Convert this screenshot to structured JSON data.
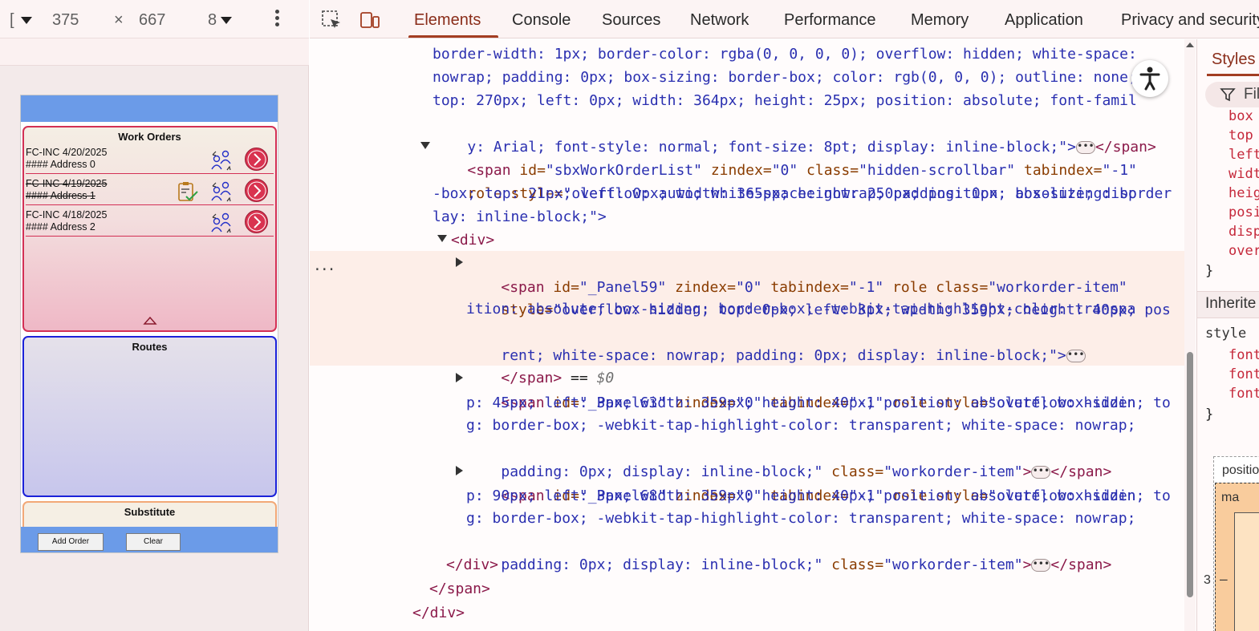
{
  "device_toolbar": {
    "device_label": "[",
    "width": "375",
    "times": "×",
    "height": "667",
    "zoom": "8"
  },
  "phone_app": {
    "work_orders_title": "Work Orders",
    "work_orders": [
      {
        "line1": "FC-INC 4/20/2025",
        "line2": "#### Address 0"
      },
      {
        "line1": "FC-INC 4/19/2025",
        "line2": "#### Address 1"
      },
      {
        "line1": "FC-INC 4/18/2025",
        "line2": "#### Address 2"
      }
    ],
    "routes_title": "Routes",
    "substitute_title": "Substitute",
    "add_order_label": "Add Order",
    "clear_label": "Clear"
  },
  "devtools_tabs": [
    "Elements",
    "Console",
    "Sources",
    "Network",
    "Performance",
    "Memory",
    "Application",
    "Privacy and security"
  ],
  "code": {
    "l1": "border-width: 1px; border-color: rgba(0, 0, 0, 0); overflow: hidden; white-space:",
    "l2": "nowrap; padding: 0px; box-sizing: border-box; color: rgb(0, 0, 0); outline: none;",
    "l3": "top: 270px; left: 0px; width: 364px; height: 25px; position: absolute; font-famil",
    "l4": "y: Arial; font-style: normal; font-size: 8pt; display: inline-block;\">",
    "l4_close": "</span>",
    "l5_open": "<span ",
    "l5_id_attr": "id=",
    "l5_id_val": "\"sbxWorkOrderList\"",
    "l5_z_attr": " zindex=",
    "l5_z_val": "\"0\"",
    "l5_c_attr": " class=",
    "l5_c_val": "\"hidden-scrollbar\"",
    "l5_t_attr": " tabindex=",
    "l5_t_val": "\"-1\"",
    "l6_attr": "role style=",
    "l6_val": "\"overflow: auto; white-space: nowrap; padding: 0px; box-sizing: border",
    "l7": "-box; top: 21px; left: 0px; width: 365px; height: 250px; position: absolute; disp",
    "l8": "lay: inline-block;\">",
    "l9": "<div>",
    "p59_a": "<span ",
    "p59_b": "id=",
    "p59_c": "\"_Panel59\"",
    "p59_d": " zindex=",
    "p59_e": "\"0\"",
    "p59_f": " tabindex=",
    "p59_g": "\"-1\"",
    "p59_h": " role class=",
    "p59_i": "\"workorder-item\"",
    "p59_l2a": "style=",
    "p59_l2b": "\"overflow: hidden; top: 0px; left: 3px; width: 359px; height: 40px; pos",
    "p59_l3": "ition: absolute; box-sizing: border-box; -webkit-tap-highlight-color: transpa",
    "p59_l4": "rent; white-space: nowrap; padding: 0px; display: inline-block;\">",
    "p59_close": "</span>",
    "p59_eq": " == ",
    "p59_dollar": "$0",
    "p63_a": "<span ",
    "p63_b": "id=",
    "p63_c": "\"_Panel63\"",
    "p63_d": " zindex=",
    "p63_e": "\"0\"",
    "p63_f": " tabindex=",
    "p63_g": "\"-1\"",
    "p63_h": " role style=",
    "p63_i": "\"overflow: hidden; to",
    "p63_l2": "p: 45px; left: 3px; width: 359px; height: 40px; position: absolute; box-sizin",
    "p63_l3": "g: border-box; -webkit-tap-highlight-color: transparent; white-space: nowrap;",
    "p63_l4a": "padding: 0px; display: inline-block;\"",
    "p63_l4b": " class=",
    "p63_l4c": "\"workorder-item\"",
    "p63_l4d": ">",
    "p63_close": "</span>",
    "p68_a": "<span ",
    "p68_b": "id=",
    "p68_c": "\"_Panel68\"",
    "p68_d": " zindex=",
    "p68_e": "\"0\"",
    "p68_f": " tabindex=",
    "p68_g": "\"-1\"",
    "p68_h": " role style=",
    "p68_i": "\"overflow: hidden; to",
    "p68_l2": "p: 90px; left: 3px; width: 359px; height: 40px; position: absolute; box-sizin",
    "p68_l3": "g: border-box; -webkit-tap-highlight-color: transparent; white-space: nowrap;",
    "p68_l4a": "padding: 0px; display: inline-block;\"",
    "p68_l4b": " class=",
    "p68_l4c": "\"workorder-item\"",
    "p68_l4d": ">",
    "p68_close": "</span>",
    "end_div": "</div>",
    "end_span": "</span>",
    "end_div2": "</div>",
    "gutter": "..."
  },
  "styles": {
    "tab_label": "Styles",
    "filter_placeholder": "Fil",
    "props": [
      "box",
      "top",
      "left",
      "widt",
      "heig",
      "posi",
      "disp",
      "over"
    ],
    "brace_close": "}",
    "inherited_label": "Inherite",
    "style_label": "style",
    "font_props": [
      "font",
      "font",
      "font"
    ],
    "brace_close2": "}",
    "box_position_label": "positio",
    "box_margin_label": "ma",
    "box_value": "3",
    "box_dash": "–"
  },
  "colors": {
    "accent": "#a33e22",
    "tag": "#8b1a4a",
    "attr_name": "#8a3c00",
    "attr_value": "#2a2fb0",
    "work_orders_border": "#d33055",
    "routes_border": "#1b22d9",
    "phone_bar": "#6b9be8"
  }
}
